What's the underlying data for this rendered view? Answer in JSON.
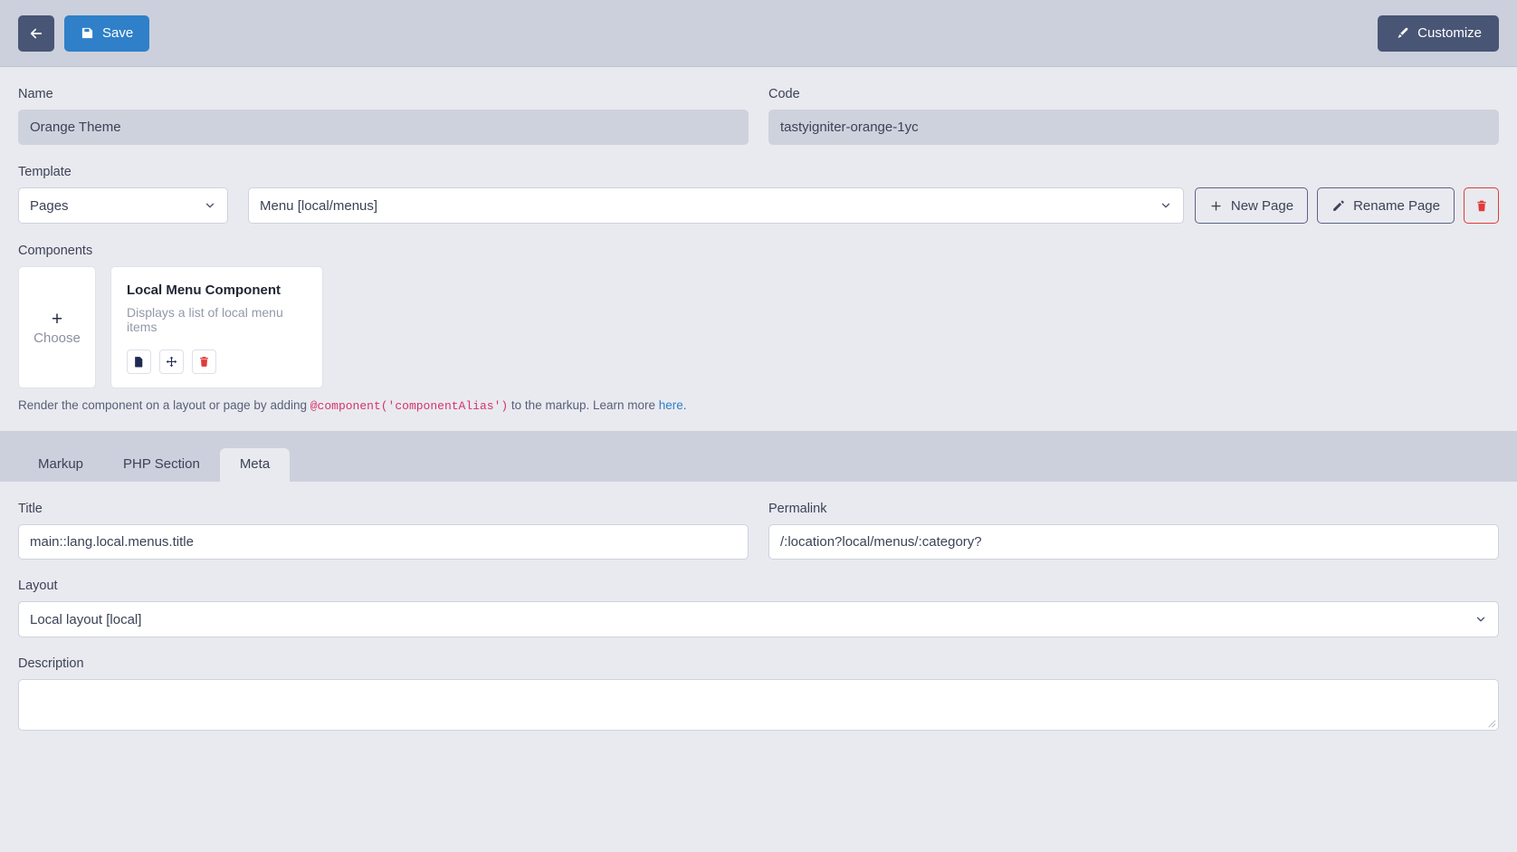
{
  "toolbar": {
    "back_label": "",
    "back_icon": "arrow-left-icon",
    "save_label": "Save",
    "save_icon": "floppy-disk-icon",
    "customize_label": "Customize",
    "customize_icon": "paintbrush-icon",
    "accent_primary": "#2f80c8",
    "accent_dark": "#495575",
    "bar_background": "#ccd0dc"
  },
  "form": {
    "name_label": "Name",
    "name_value": "Orange Theme",
    "name_disabled": true,
    "code_label": "Code",
    "code_value": "tastyigniter-orange-1yc",
    "code_disabled": true,
    "template_label": "Template",
    "template_type_value": "Pages",
    "template_file_value": "Menu [local/menus]",
    "new_page_label": "New Page",
    "new_page_icon": "plus-icon",
    "rename_page_label": "Rename Page",
    "rename_page_icon": "pencil-icon",
    "delete_page_icon": "trash-icon",
    "delete_color": "#e23a3a"
  },
  "components": {
    "label": "Components",
    "choose_label": "Choose",
    "choose_icon": "plus-icon",
    "cards": [
      {
        "title": "Local Menu Component",
        "description": "Displays a list of local menu items",
        "actions": [
          {
            "icon": "file-code-icon",
            "name": "view-component-file-button"
          },
          {
            "icon": "move-arrows-icon",
            "name": "move-component-button"
          },
          {
            "icon": "trash-icon",
            "name": "delete-component-button"
          }
        ]
      }
    ],
    "hint_prefix": "Render the component on a layout or page by adding ",
    "hint_code": "@component('componentAlias')",
    "hint_suffix": " to the markup. Learn more ",
    "hint_link": "here",
    "hint_end": "."
  },
  "tabs": [
    {
      "label": "Markup",
      "active": false
    },
    {
      "label": "PHP Section",
      "active": false
    },
    {
      "label": "Meta",
      "active": true
    }
  ],
  "meta": {
    "title_label": "Title",
    "title_value": "main::lang.local.menus.title",
    "permalink_label": "Permalink",
    "permalink_value": "/:location?local/menus/:category?",
    "layout_label": "Layout",
    "layout_value": "Local layout [local]",
    "description_label": "Description",
    "description_value": ""
  }
}
